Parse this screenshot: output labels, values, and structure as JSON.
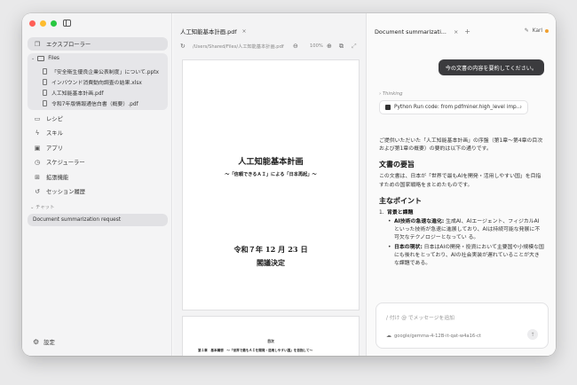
{
  "sidebar": {
    "explorer_label": "エクスプローラー",
    "files": {
      "folder_label": "Files",
      "items": [
        "「安全衛生優良企業公表制度」について.pptx",
        "インバウンド消費動向調査の結果.xlsx",
        "人工知能基本計画.pdf",
        "令和7年版情報通信白書（概要）.pdf"
      ]
    },
    "nav": [
      {
        "label": "レシピ",
        "icon": "document-icon"
      },
      {
        "label": "スキル",
        "icon": "bolt-icon"
      },
      {
        "label": "アプリ",
        "icon": "window-icon"
      },
      {
        "label": "スケジューラー",
        "icon": "clock-icon"
      },
      {
        "label": "拡張機能",
        "icon": "puzzle-icon"
      },
      {
        "label": "セッション履歴",
        "icon": "history-icon"
      }
    ],
    "chat_section_label": "チャット",
    "chat_item": "Document summarization request",
    "settings_label": "設定"
  },
  "document": {
    "tab_label": "人工知能基本計画.pdf",
    "path": "/Users/Shared/Files/人工知能基本計画.pdf",
    "zoom": "100%",
    "page1": {
      "title": "人工知能基本計画",
      "subtitle": "～「信頼できるＡＩ」による「日本再起」～",
      "date": "令和７年 12 月 23 日",
      "decision": "閣議決定"
    },
    "page2": {
      "heading": "目次",
      "line": "第１章　基本構想　～「世界で最もＡＩを開発・活用しやすい国」を目指して～"
    }
  },
  "chat": {
    "tab_label": "Document summarizati...",
    "user_name": "Karl",
    "user_message": "今の文書の内容を要約してください。",
    "thinking_label": "Thinking",
    "tool_call": "Python Run code: from pdfminer.high_level imp...",
    "response": {
      "intro": "ご提供いただいた「人工知能基本計画」の序盤（第1章〜第4章の目次および第1章の概要）の要約は以下の通りです。",
      "h1": "文書の要旨",
      "summary": "この文書は、日本が「世界で最もAIを開発・活用しやすい国」を目指すための国家戦略をまとめたものです。",
      "h2": "主なポイント",
      "point1_title": "背景と課題",
      "bullet1_bold": "AI技術の急速な進化:",
      "bullet1_text": " 生成AI、AIエージェント、フィジカルAIといった技術が急速に進展しており、AIは持続可能な発展に不可欠なテクノロジーとなってい る。",
      "bullet2_bold": "日本の現状:",
      "bullet2_text": " 日本はAIの開発・投資において主要国や小規模な国にも後れをとっており、AIの社会実装が遅れていることが大きな課題である。"
    },
    "composer": {
      "placeholder": "/ 付け @ でメッセージを追加",
      "model": "google/gemma-4-12B-it-qat-w4a16-ct"
    }
  }
}
